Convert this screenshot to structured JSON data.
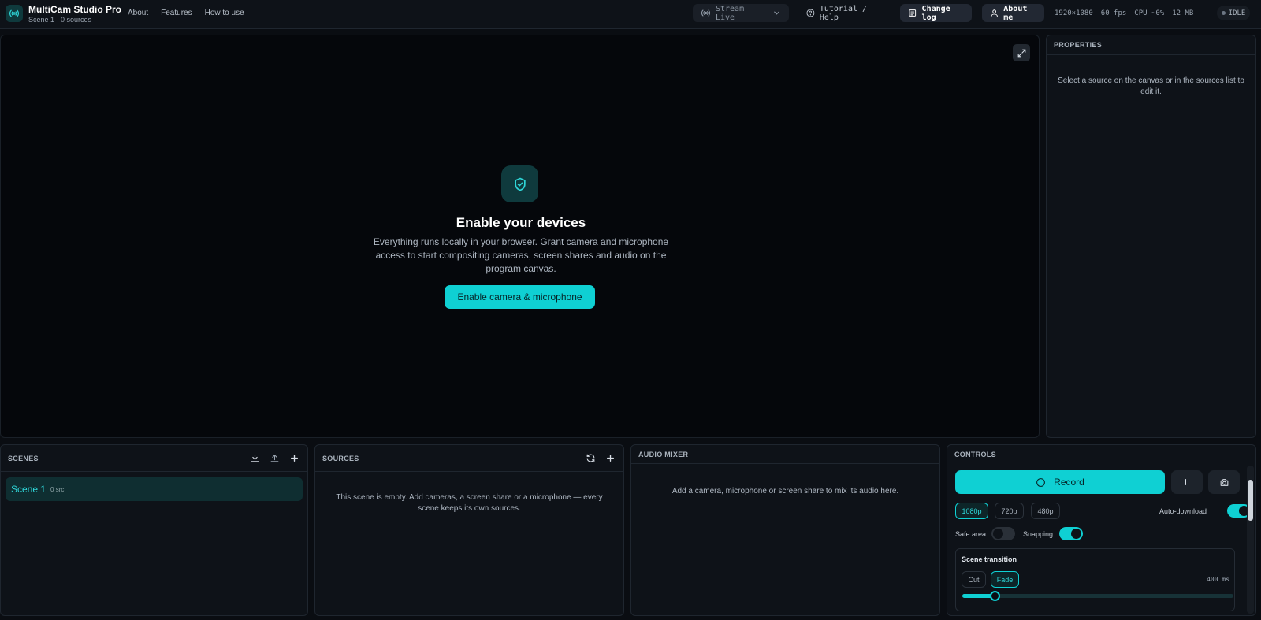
{
  "app": {
    "title": "MultiCam Studio Pro",
    "subtitle": "Scene 1 · 0 sources"
  },
  "nav": [
    "About",
    "Features",
    "How to use"
  ],
  "toolbar": {
    "stream_label": "Stream Live",
    "tutorial_label": "Tutorial / Help",
    "changelog_label": "Change log",
    "about_label": "About me"
  },
  "stats": {
    "resolution": "1920×1080",
    "fps": "60 fps",
    "cpu": "CPU ~0%",
    "memory": "12 MB",
    "status": "IDLE"
  },
  "canvas": {
    "title": "Enable your devices",
    "description": "Everything runs locally in your browser. Grant camera and microphone access to start compositing cameras, screen shares and audio on the program canvas.",
    "button_label": "Enable camera & microphone"
  },
  "properties": {
    "heading": "PROPERTIES",
    "empty_message": "Select a source on the canvas or in the sources list to edit it."
  },
  "scenes": {
    "heading": "SCENES",
    "items": [
      {
        "name": "Scene 1",
        "count": "0 src"
      }
    ]
  },
  "sources": {
    "heading": "SOURCES",
    "empty_message": "This scene is empty. Add cameras, a screen share or a microphone — every scene keeps its own sources."
  },
  "audio": {
    "heading": "AUDIO MIXER",
    "empty_message": "Add a camera, microphone or screen share to mix its audio here."
  },
  "controls": {
    "heading": "CONTROLS",
    "record_label": "Record",
    "resolutions": [
      "1080p",
      "720p",
      "480p"
    ],
    "selected_resolution": "1080p",
    "auto_download_label": "Auto-download",
    "auto_download": true,
    "safe_area_label": "Safe area",
    "safe_area": false,
    "snapping_label": "Snapping",
    "snapping": true,
    "transition": {
      "heading": "Scene transition",
      "options": [
        "Cut",
        "Fade"
      ],
      "selected": "Fade",
      "duration_label": "400 ms",
      "duration_fraction": 0.12
    }
  },
  "colors": {
    "accent": "#0fd0d3",
    "background": "#0a0d12",
    "panel": "#0e1218"
  }
}
